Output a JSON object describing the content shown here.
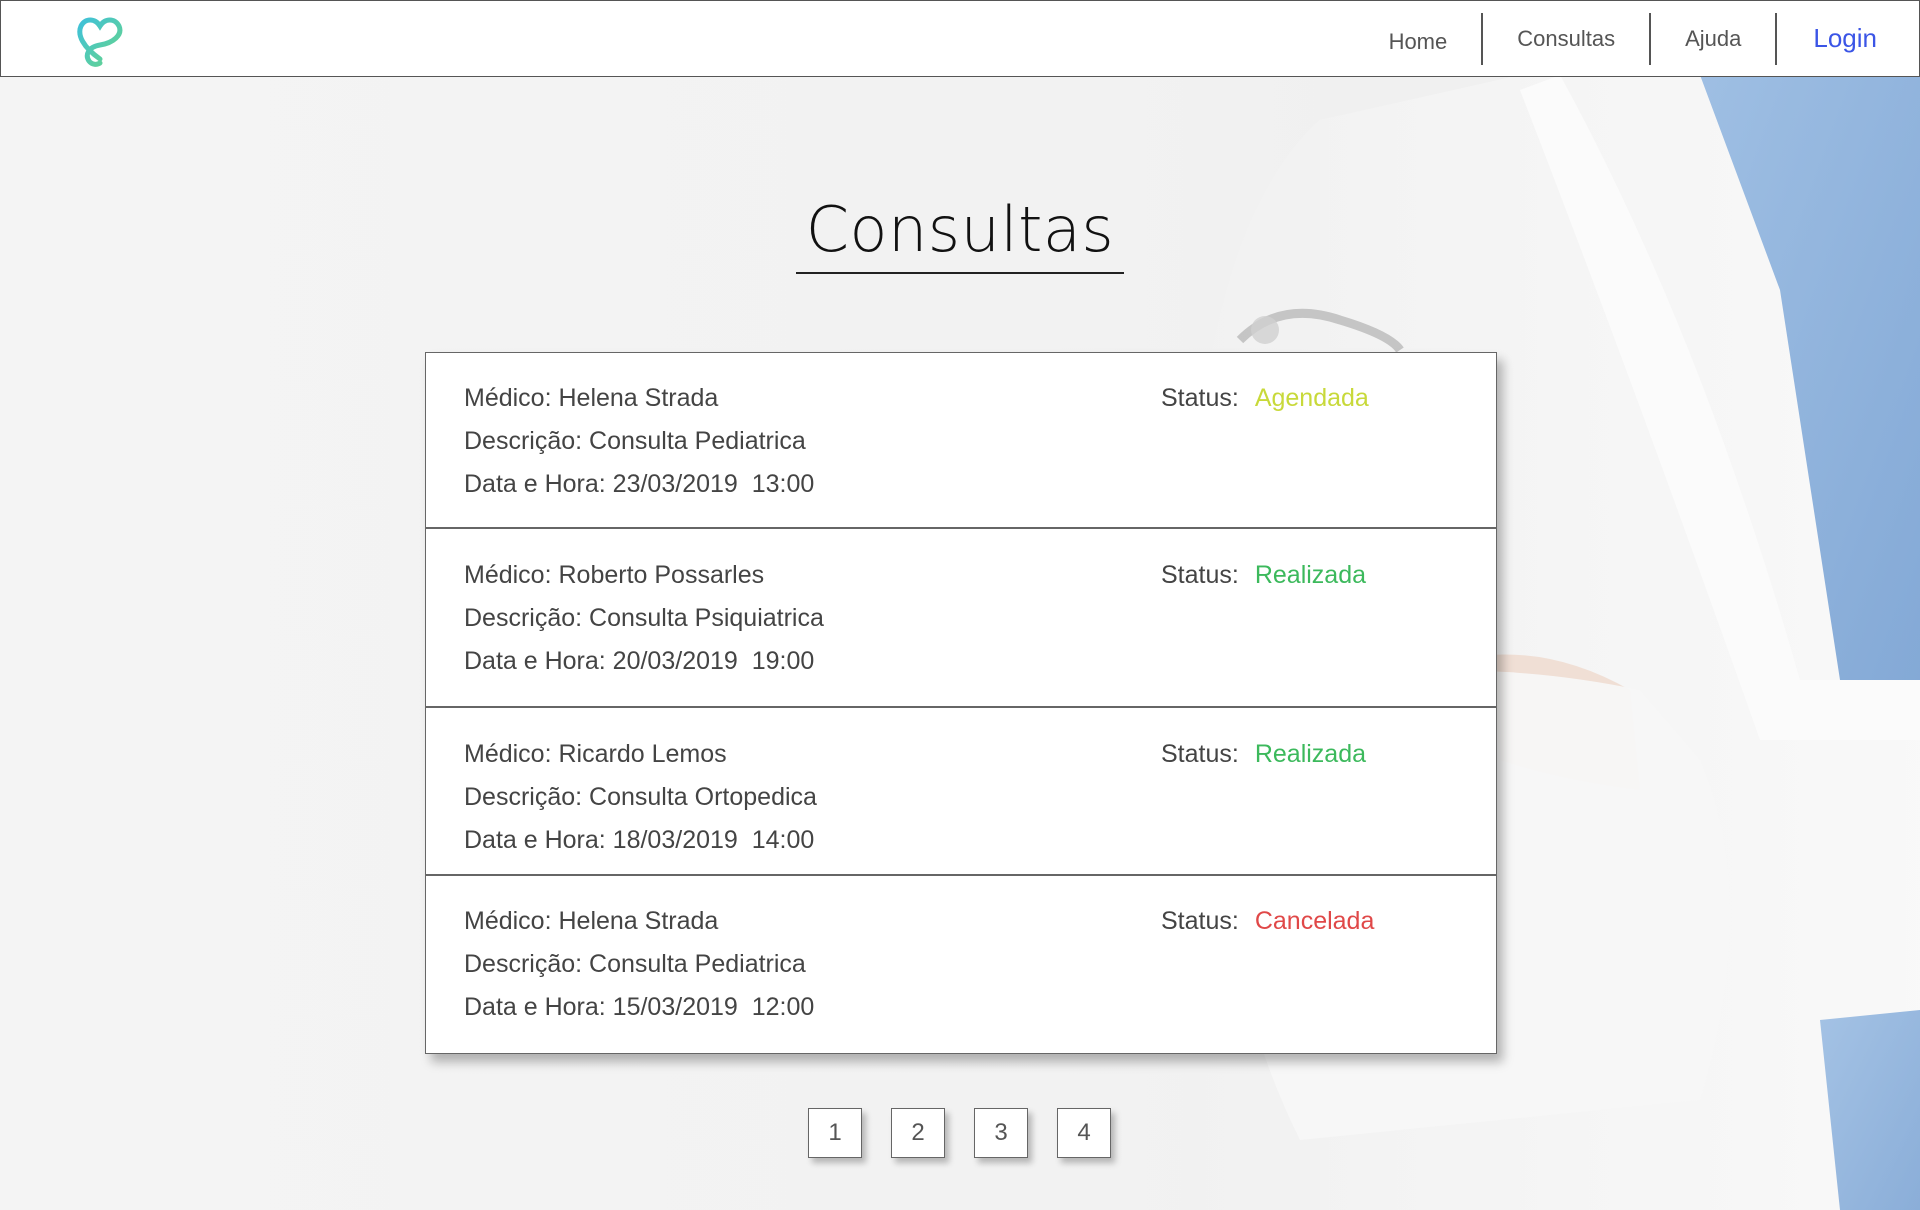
{
  "header": {
    "logo_icon": "heart-s-logo-icon",
    "nav": [
      {
        "label": "Home"
      },
      {
        "label": "Consultas"
      },
      {
        "label": "Ajuda"
      },
      {
        "label": "Login"
      }
    ],
    "login_color": "#3b55e6"
  },
  "page": {
    "title": "Consultas"
  },
  "consultas": [
    {
      "medico": "Médico: Helena Strada",
      "descricao": "Descrição: Consulta Pediatrica",
      "data_hora": "Data e Hora: 23/03/2019  13:00",
      "status_label": "Status:",
      "status": "Agendada",
      "status_color": "#c8d93a"
    },
    {
      "medico": "Médico: Roberto Possarles",
      "descricao": "Descrição: Consulta Psiquiatrica",
      "data_hora": "Data e Hora: 20/03/2019  19:00",
      "status_label": "Status:",
      "status": "Realizada",
      "status_color": "#3cb95c"
    },
    {
      "medico": "Médico: Ricardo Lemos",
      "descricao": "Descrição: Consulta Ortopedica",
      "data_hora": "Data e Hora: 18/03/2019  14:00",
      "status_label": "Status:",
      "status": "Realizada",
      "status_color": "#3cb95c"
    },
    {
      "medico": "Médico: Helena Strada",
      "descricao": "Descrição: Consulta Pediatrica",
      "data_hora": "Data e Hora: 15/03/2019  12:00",
      "status_label": "Status:",
      "status": "Cancelada",
      "status_color": "#e04848"
    }
  ],
  "pagination": [
    "1",
    "2",
    "3",
    "4"
  ]
}
